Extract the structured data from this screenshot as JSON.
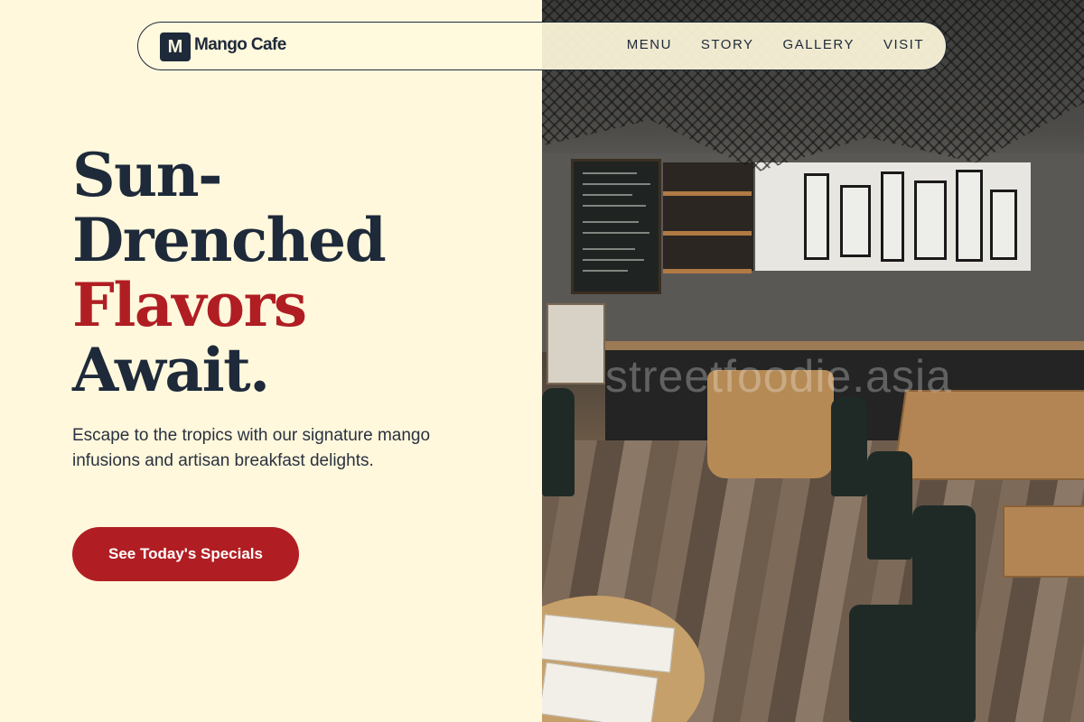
{
  "brand": {
    "logo_letter": "M",
    "name": "Mango Cafe"
  },
  "nav": {
    "items": [
      "MENU",
      "STORY",
      "GALLERY",
      "VISIT"
    ]
  },
  "hero": {
    "headline_line1": "Sun-",
    "headline_line2": "Drenched",
    "headline_accent": "Flavors",
    "headline_line4": "Await.",
    "subtitle": "Escape to the tropics with our signature mango infusions and artisan breakfast delights.",
    "cta_label": "See Today's Specials"
  },
  "image": {
    "watermark_text": "streetfoodie.asia"
  },
  "colors": {
    "background": "#FFF8DC",
    "navy": "#1E2A3A",
    "accent_red": "#B01E23"
  }
}
